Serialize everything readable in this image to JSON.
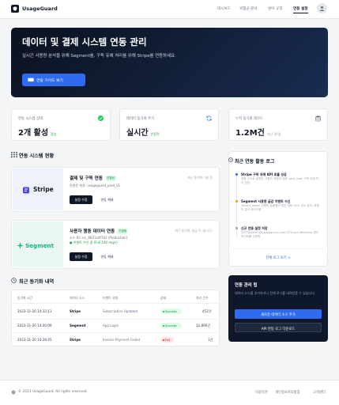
{
  "header": {
    "brand": "UsageGuard",
    "nav": [
      "대시보드",
      "위험군 분석",
      "방어 규칙",
      "연동 설정"
    ],
    "active_nav": "연동 설정"
  },
  "hero": {
    "title": "데이터 및 결제 시스템 연동 관리",
    "subtitle": "실시간 사용량 분석을 위해 Segment를, 구독 유예 처리를 위해 Stripe를 연동하세요.",
    "button": "연동 가이드 보기"
  },
  "stats": [
    {
      "label": "연동 시스템 상태",
      "value": "2개 활성",
      "note": "정상",
      "note_color": "#16a34a",
      "icon": "check-circle-icon"
    },
    {
      "label": "데이터 동기화 주기",
      "value": "실시간",
      "note": "안정적",
      "note_color": "#16a34a",
      "icon": "refresh-icon"
    },
    {
      "label": "누적 동기화 레코드",
      "value": "1.2M건",
      "note": "지난 30일",
      "note_color": "#9ca3af",
      "icon": "database-icon"
    }
  ],
  "integrations_section": {
    "title": "연동 시스템 현황"
  },
  "integrations": [
    {
      "logo": "Stripe",
      "name": "결제 및 구독 연동",
      "status": "연결됨",
      "meta": [
        "연결된 계정: usageguard_prod_01"
      ],
      "last_sync": "최근 동기화: 5분 전",
      "primary": "설정 수정",
      "secondary": "연동 해제"
    },
    {
      "logo": "Segment",
      "name": "사용자 행동 데이터 연동",
      "status": "연결됨",
      "meta": [
        "소스 ID: src_8821a4f7b2 (Production)",
        "● 이벤트 수신 중 (Full 100 req/s)"
      ],
      "last_sync": "최근 동기화: 방금 전 (실시간)",
      "primary": "설정 수정",
      "secondary": "연동 해제"
    }
  ],
  "history": {
    "title": "최근 동기화 내역",
    "columns": [
      "동기화 시간",
      "데이터 소스",
      "이벤트 유형",
      "상태",
      "처리 건수"
    ],
    "rows": [
      {
        "time": "2023-11-20 14:32:11",
        "source": "Stripe",
        "event": "Subscription Updated",
        "status": "Success",
        "count": "452건"
      },
      {
        "time": "2023-11-20 14:30:00",
        "source": "Segment",
        "event": "App Login",
        "status": "Success",
        "count": "12,890건"
      },
      {
        "time": "2023-11-20 14:28:45",
        "source": "Stripe",
        "event": "Invoice Payment Failed",
        "status": "Fail",
        "count": "1건"
      }
    ]
  },
  "activity": {
    "title": "최근 연동 활동 로그",
    "items": [
      {
        "title": "Stripe 구독 유예 API 호출 성공",
        "body": "위험 군으로 분류된 사용자 계정에 대해 'past_due' 구독 유예 처리 성공",
        "color": "#2563eb"
      },
      {
        "title": "Segment 사용량 급감 이벤트 수신",
        "body": "'active_users' 이벤트 호출량이 평균 대비 40% 감소 감지, 위험도 분석 트리거됨",
        "color": "#f59e0b"
      },
      {
        "title": "신규 연동 설정 저장",
        "body": "관리자(admin@usageguard.com)가 Stripe Webhook 엔드포인트를 수정함",
        "color": "#9ca3af"
      }
    ],
    "more": "전체 로그 보기 >"
  },
  "quick": {
    "title": "연동 관리 팁",
    "subtitle": "데이터 소스를 추가하거나 전체 로그를 내려받을 수 있습니다.",
    "buttons": [
      "새로운 데이터 소스 추가",
      "API 연동 로그 다운로드"
    ]
  },
  "footer": {
    "copyright": "© 2023 UsageGuard. All rights reserved.",
    "links": [
      "이용약관",
      "개인정보처리방침",
      "고객센터"
    ]
  }
}
